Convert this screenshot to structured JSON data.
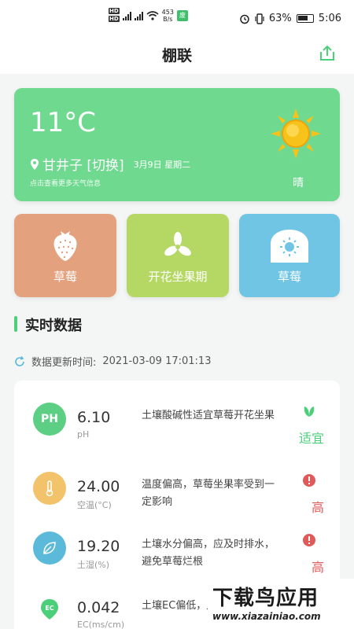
{
  "status_bar": {
    "network_speed": "453",
    "network_unit": "B/s",
    "eco_label": "废",
    "battery": "63%",
    "time": "5:06",
    "hd_label": "HD"
  },
  "header": {
    "title": "棚联"
  },
  "weather": {
    "temperature": "11°C",
    "location": "甘井子 [切换]",
    "date": "3月9日 星期二",
    "more_info": "点击查看更多天气信息",
    "condition": "晴",
    "color": "#6fd98f"
  },
  "tiles": [
    {
      "label": "草莓",
      "icon": "strawberry-icon",
      "color": "#e3a17e"
    },
    {
      "label": "开花坐果期",
      "icon": "flower-icon",
      "color": "#b5d865"
    },
    {
      "label": "草莓",
      "icon": "greenhouse-icon",
      "color": "#70c5e4"
    }
  ],
  "section": {
    "title": "实时数据",
    "update_label": "数据更新时间:",
    "update_time": "2021-03-09 17:01:13"
  },
  "data_rows": [
    {
      "icon_text": "PH",
      "icon": "ph-icon",
      "value": "6.10",
      "unit": "pH",
      "desc": "土壤酸碱性适宜草莓开花坐果",
      "status": "适宜",
      "status_icon": "leaf-icon",
      "color": "#5ccf84"
    },
    {
      "icon_text": "",
      "icon": "thermometer-icon",
      "value": "24.00",
      "unit": "空温(°C)",
      "desc": "温度偏高，草莓坐果率受到一定影响",
      "status": "高",
      "status_icon": "alert-icon",
      "color": "#f3c36b"
    },
    {
      "icon_text": "",
      "icon": "soil-moisture-icon",
      "value": "19.20",
      "unit": "土湿(%)",
      "desc": "土壤水分偏高，应及时排水，避免草莓烂根",
      "status": "高",
      "status_icon": "alert-icon",
      "color": "#5bb9d9"
    },
    {
      "icon_text": "EC",
      "icon": "ec-icon",
      "value": "0.042",
      "unit": "EC(ms/cm)",
      "desc": "土壤EC偏低，足，影响草莓",
      "status": "",
      "status_icon": "",
      "color": "#4ccf7a"
    }
  ],
  "watermark": {
    "big": "下载鸟应用",
    "small": "www.xiazainiao.com"
  }
}
